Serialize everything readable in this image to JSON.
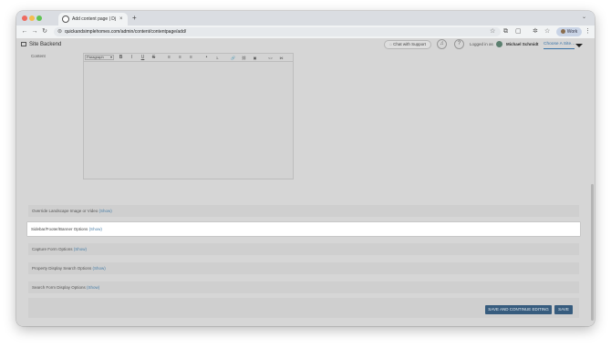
{
  "browser": {
    "tab_title": "Add content page | Django s",
    "tab_close": "×",
    "new_tab": "+",
    "tab_menu": "⌄",
    "url": "quickandsimplehomes.com/admin/content/contentpage/add/",
    "profile_label": "Work",
    "icons": [
      "back-icon",
      "forward-icon",
      "reload-icon",
      "site-info-icon",
      "bookmark-star-icon",
      "extensions-icon",
      "downloads-icon",
      "profile-icon",
      "menu-icon"
    ]
  },
  "site": {
    "title": "Site Backend",
    "chat_label": "Chat with Support",
    "logged_in_label": "Logged in as",
    "username": "Michael Schmidt",
    "choose_site": "Choose A Site..."
  },
  "editor": {
    "field_label": "Content",
    "format_select": "Paragraph",
    "toolbar_buttons": [
      "B",
      "I",
      "U",
      "S",
      "≡",
      "≡",
      "≡",
      "•",
      "1.",
      "🔗",
      "⛓",
      "▣",
      "<>",
      "⋈"
    ]
  },
  "sections": [
    {
      "label": "Override Landscape Image or Video",
      "action": "(Show)"
    },
    {
      "label": "Sidebar/Footer/Banner Options",
      "action": "(Show)",
      "highlighted": true
    },
    {
      "label": "Capture Form Options",
      "action": "(Show)"
    },
    {
      "label": "Property Display Search Options",
      "action": "(Show)"
    },
    {
      "label": "Search Form Display Options",
      "action": "(Show)"
    }
  ],
  "buttons": {
    "save_continue": "SAVE AND CONTINUE EDITING",
    "save": "SAVE"
  }
}
